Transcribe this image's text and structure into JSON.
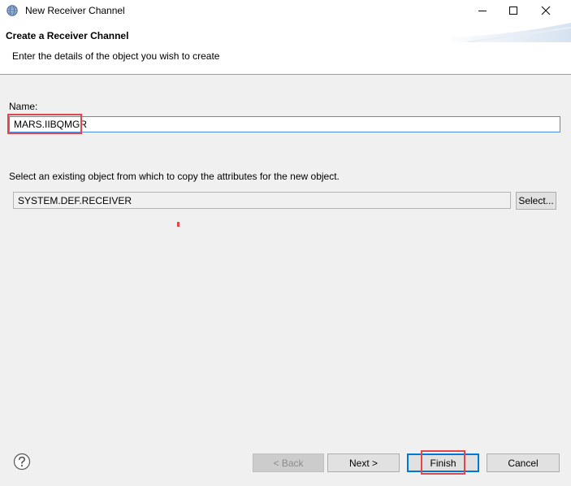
{
  "window": {
    "title": "New Receiver Channel",
    "controls": {
      "minimize_icon": "minimize-icon",
      "maximize_icon": "maximize-icon",
      "close_icon": "close-icon"
    }
  },
  "header": {
    "title": "Create a Receiver Channel",
    "description": "Enter the details of the object you wish to create"
  },
  "form": {
    "name_label": "Name:",
    "name_value": "MARS.IIBQMGR",
    "copy_label": "Select an existing object from which to copy the attributes for the new object.",
    "copy_value": "SYSTEM.DEF.RECEIVER",
    "select_button": "Select..."
  },
  "footer": {
    "help_icon": "help-icon",
    "back_button": "< Back",
    "next_button": "Next >",
    "finish_button": "Finish",
    "cancel_button": "Cancel"
  },
  "colors": {
    "highlight": "#e0464c",
    "focus_border": "#0078d7",
    "panel_bg": "#f0f0f0"
  }
}
